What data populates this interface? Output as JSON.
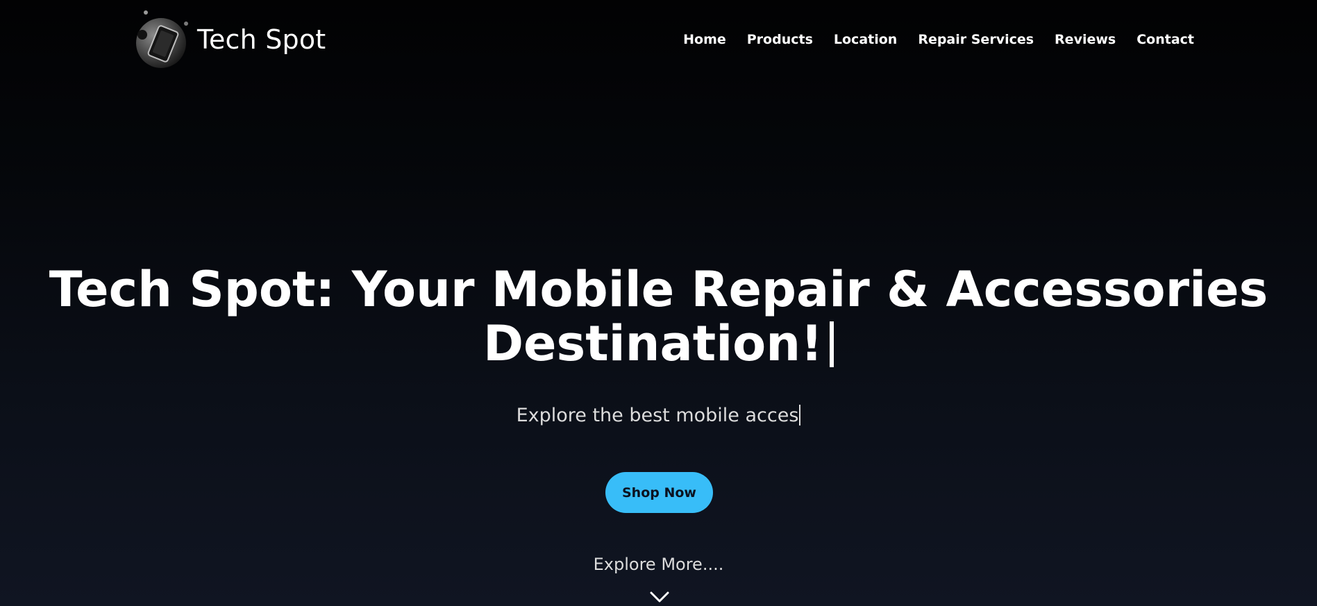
{
  "header": {
    "brand_name": "Tech Spot",
    "logo_icon": "phone-logo-icon",
    "nav": [
      {
        "label": "Home"
      },
      {
        "label": "Products"
      },
      {
        "label": "Location"
      },
      {
        "label": "Repair Services"
      },
      {
        "label": "Reviews"
      },
      {
        "label": "Contact"
      }
    ]
  },
  "hero": {
    "title_line1": "Tech Spot: Your Mobile Repair & Accessories",
    "title_line2": "Destination!",
    "subtitle": "Explore the best mobile acces",
    "cta_label": "Shop Now",
    "explore_label": "Explore More....",
    "scroll_icon": "chevron-down-icon"
  },
  "colors": {
    "accent": "#38bdf8",
    "background_top": "#020203",
    "background_bottom": "#101522",
    "text": "#ffffff"
  }
}
